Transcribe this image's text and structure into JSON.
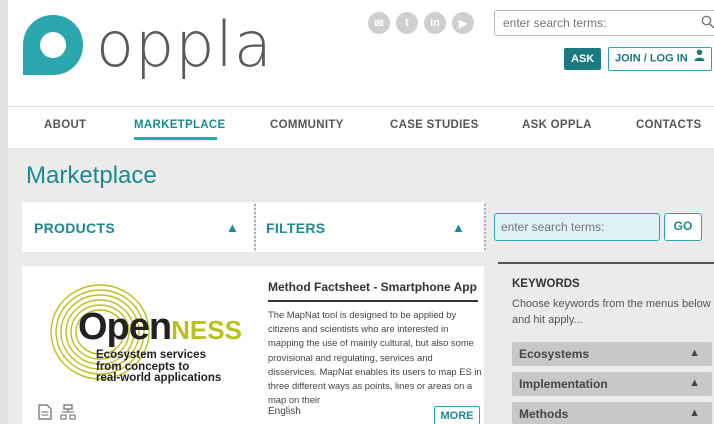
{
  "brand": {
    "name": "oppla",
    "teal": "#1b8a90",
    "accent": "#2aa7ad"
  },
  "header": {
    "social": [
      "mail-icon",
      "twitter-icon",
      "linkedin-icon",
      "youtube-icon"
    ],
    "social_glyphs": [
      "✉",
      "t",
      "in",
      "▶"
    ],
    "search_placeholder": "enter search terms:",
    "ask_label": "ASK",
    "join_label": "JOIN / LOG IN"
  },
  "nav": {
    "items": [
      {
        "label": "ABOUT",
        "active": false
      },
      {
        "label": "MARKETPLACE",
        "active": true
      },
      {
        "label": "COMMUNITY",
        "active": false
      },
      {
        "label": "CASE STUDIES",
        "active": false
      },
      {
        "label": "ASK OPPLA",
        "active": false
      },
      {
        "label": "CONTACTS",
        "active": false
      }
    ]
  },
  "page": {
    "title": "Marketplace"
  },
  "panels": {
    "products": "PRODUCTS",
    "filters": "FILTERS",
    "search_placeholder": "enter search terms:",
    "go_label": "GO"
  },
  "card": {
    "logo_name_main": "Open",
    "logo_name_accent": "NESS",
    "logo_tagline": [
      "Ecosystem services",
      "from concepts to",
      "real-world applications"
    ],
    "title": "Method Factsheet - Smartphone App",
    "description": "The MapNat tool is designed to be applied by citizens and scientists who are interested in mapping the use of mainly cultural, but also some provisional and regulating, services and disservices. MapNat enables its users to map ES in three different ways as points, lines or areas on a map on their",
    "language": "English",
    "more_label": "MORE"
  },
  "keywords": {
    "title": "KEYWORDS",
    "description": "Choose keywords from the menus below and hit apply...",
    "groups": [
      "Ecosystems",
      "Implementation",
      "Methods"
    ]
  }
}
